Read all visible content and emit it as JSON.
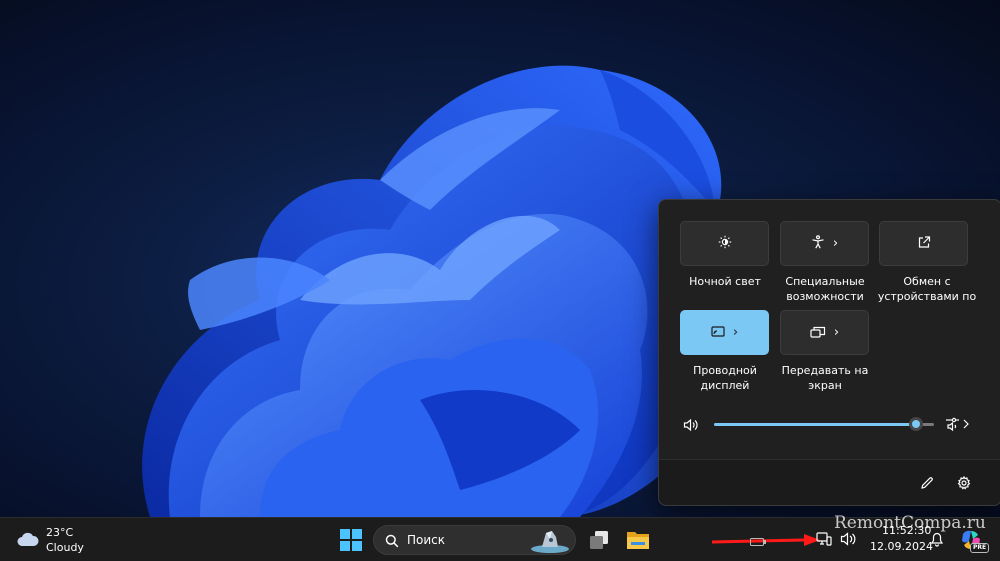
{
  "quick_settings": {
    "tiles": [
      {
        "label": "Ночной свет",
        "icon": "brightness-icon",
        "has_chevron": false,
        "active": false
      },
      {
        "label": "Специальные возможности",
        "icon": "accessibility-icon",
        "has_chevron": true,
        "active": false
      },
      {
        "label": "Обмен с устройствами по",
        "icon": "share-icon",
        "has_chevron": false,
        "active": false
      },
      {
        "label": "Проводной дисплей",
        "icon": "cast-icon",
        "has_chevron": true,
        "active": true
      },
      {
        "label": "Передавать на экран",
        "icon": "project-icon",
        "has_chevron": true,
        "active": false
      }
    ],
    "chevron_glyph": "›",
    "volume": {
      "level": 0.92,
      "icon": "speaker-icon",
      "output_icon": "audio-output-icon"
    },
    "footer": {
      "edit_icon": "pencil-icon",
      "settings_icon": "gear-icon"
    },
    "accent_color": "#7cc8f5"
  },
  "taskbar": {
    "weather": {
      "temperature": "23°C",
      "condition": "Cloudy",
      "icon": "cloud-icon"
    },
    "search": {
      "placeholder": "Поиск"
    },
    "clock": {
      "time": "11:52:30",
      "date": "12.09.2024"
    },
    "watermark": "RemontCompa.ru",
    "icons": [
      "start-icon",
      "search-icon",
      "task-view-icon",
      "file-explorer-icon",
      "battery-icon",
      "display-icon",
      "volume-icon",
      "notification-bell-icon",
      "copilot-icon"
    ],
    "copilot_badge": "PRE"
  }
}
